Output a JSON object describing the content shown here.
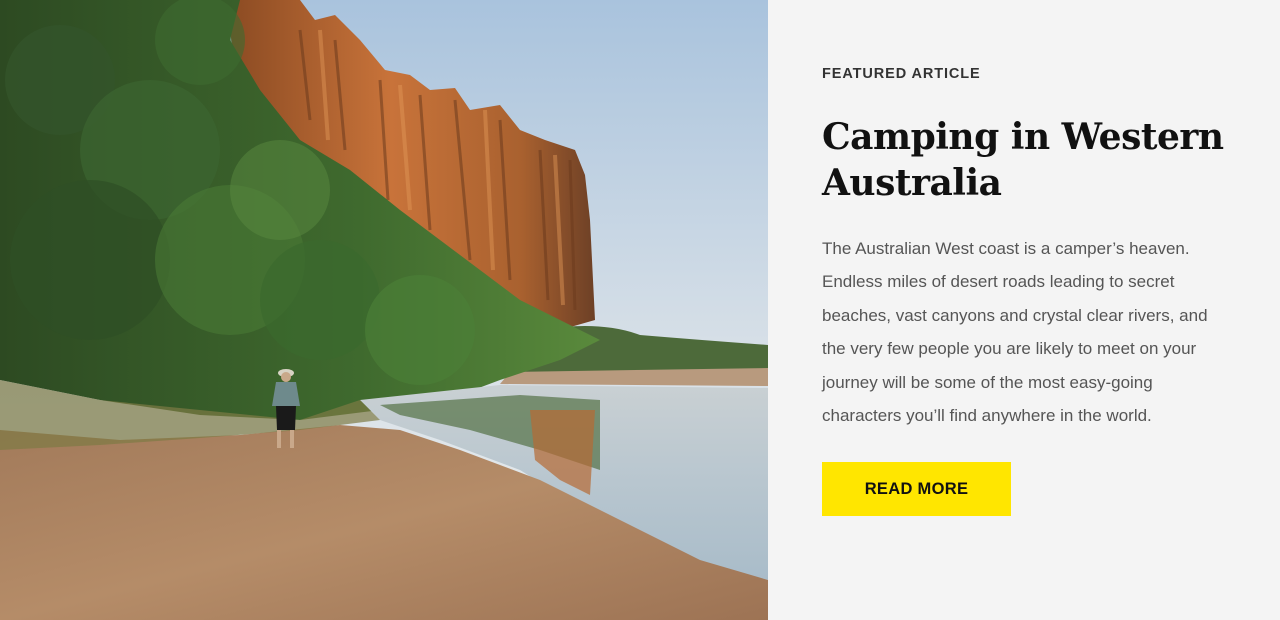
{
  "feature": {
    "eyebrow": "FEATURED ARTICLE",
    "title": "Camping in Western Australia",
    "body": "The Australian West coast is a camper’s heaven. Endless miles of desert roads leading to secret beaches, vast canyons and crystal clear rivers, and the very few people you are likely to meet on your journey will be some of the most easy-going characters you’ll find anywhere in the world.",
    "cta_label": "READ MORE"
  },
  "colors": {
    "accent": "#ffe600",
    "background": "#f4f4f4",
    "title": "#111111",
    "body": "#555555"
  }
}
